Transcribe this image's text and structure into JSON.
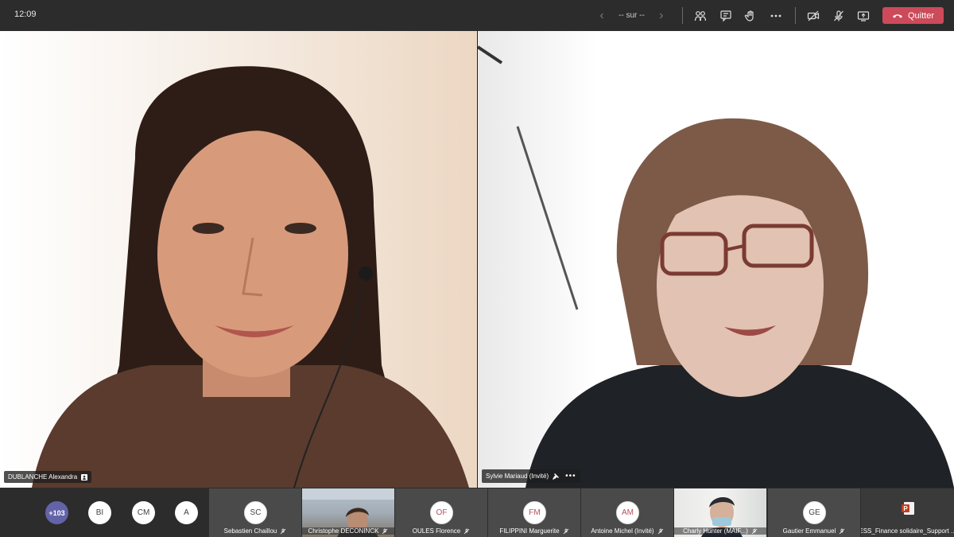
{
  "topbar": {
    "time": "12:09",
    "page_indicator": "-- sur --",
    "leave_label": "Quitter",
    "icons": [
      "participants-icon",
      "chat-icon",
      "raise-hand-icon",
      "more-actions-icon",
      "camera-icon",
      "mic-muted-icon",
      "share-screen-icon",
      "hangup-icon"
    ],
    "leave_color": "#cc4a5a"
  },
  "videos": [
    {
      "name": "DUBLANCHE Alexandra"
    },
    {
      "name": "Sylvie Mariaud (Invité)"
    }
  ],
  "strip": {
    "overflow_count": "+103",
    "avatars": [
      "BI",
      "CM",
      "A"
    ],
    "tiles": [
      {
        "initials": "SC",
        "name": "Sebastien Chaillou"
      },
      {
        "initials": "",
        "name": "Christophe DECONINCK"
      },
      {
        "initials": "OF",
        "name": "OULES Florence"
      },
      {
        "initials": "FM",
        "name": "FILIPPINI Marguerite"
      },
      {
        "initials": "AM",
        "name": "Antoine Michel (Invité)"
      },
      {
        "initials": "",
        "name": "Charly Hunter (MAIF...)"
      },
      {
        "initials": "GE",
        "name": "Gautier Emmanuel"
      },
      {
        "initials": "",
        "name": "ESS_Finance solidaire_Support ..."
      }
    ],
    "accent": "#6264a7"
  }
}
